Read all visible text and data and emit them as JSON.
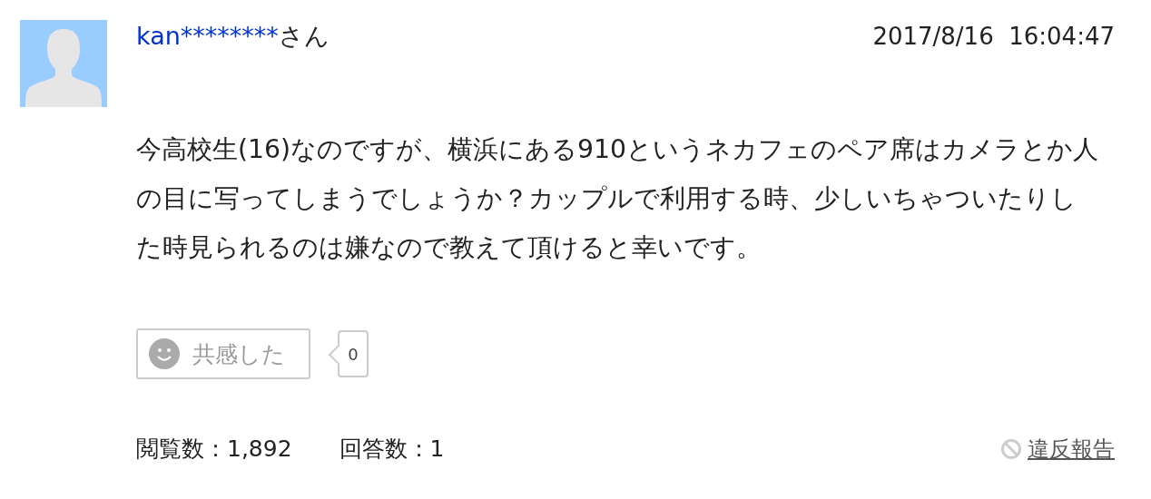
{
  "question": {
    "author": {
      "masked_name": "kan********",
      "honorific": "さん"
    },
    "posted_at": "2017/8/16  16:04:47",
    "body": "今高校生(16)なのですが、横浜にある910というネカフェのペア席はカメラとか人の目に写ってしまうでしょうか？カップルで利用する時、少しいちゃついたりした時見られるのは嫌なので教えて頂けると幸いです。",
    "empathy_button": {
      "label": "共感した",
      "count": "0"
    },
    "stats": [
      {
        "label": "閲覧数：1,892"
      },
      {
        "label": "回答数：1"
      }
    ],
    "report_link": "違反報告"
  }
}
